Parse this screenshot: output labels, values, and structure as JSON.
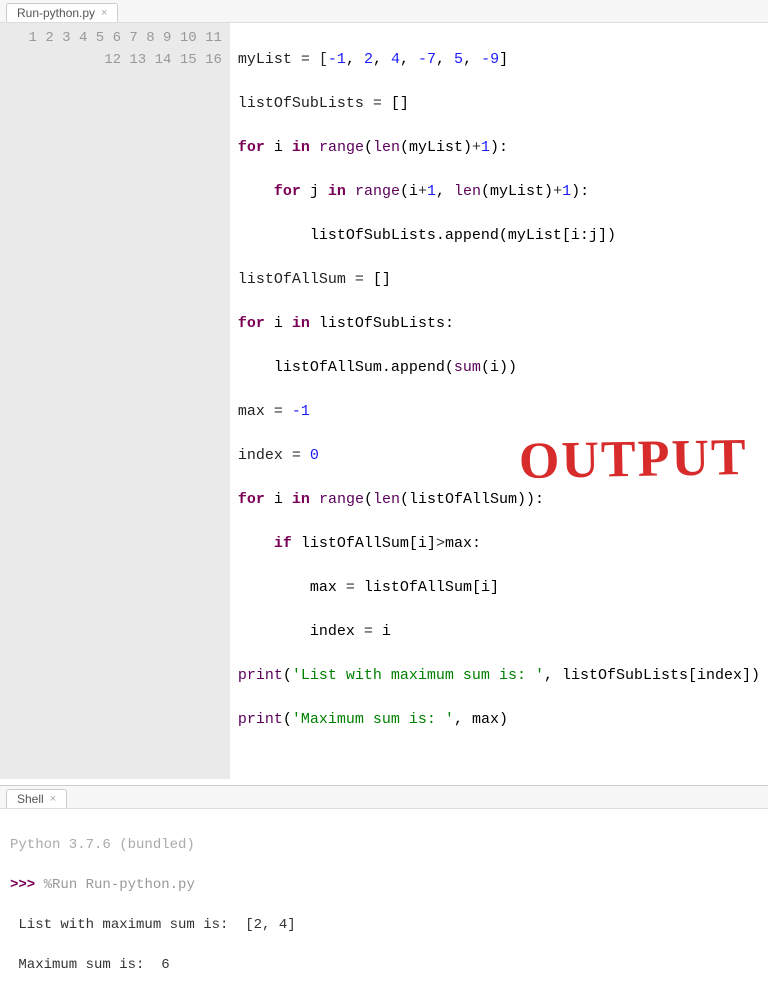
{
  "editor_tab": {
    "label": "Run-python.py"
  },
  "shell_tab": {
    "label": "Shell"
  },
  "gutter_lines": [
    "1",
    "2",
    "3",
    "4",
    "5",
    "6",
    "7",
    "8",
    "9",
    "10",
    "11",
    "12",
    "13",
    "14",
    "15",
    "16"
  ],
  "code": {
    "l1": {
      "a": "myList ",
      "b": "=",
      "c": " [",
      "n1": "-1",
      "c2": ", ",
      "n2": "2",
      "c3": ", ",
      "n3": "4",
      "c4": ", ",
      "n4": "-7",
      "c5": ", ",
      "n5": "5",
      "c6": ", ",
      "n6": "-9",
      "c7": "]"
    },
    "l2": {
      "a": "listOfSubLists ",
      "b": "=",
      "c": " []"
    },
    "l3": {
      "kw": "for",
      "a": " i ",
      "kw2": "in",
      "b": " ",
      "fn": "range",
      "c": "(",
      "fn2": "len",
      "d": "(myList)",
      "op": "+",
      "n": "1",
      "e": "):"
    },
    "l4": {
      "indent": "    ",
      "kw": "for",
      "a": " j ",
      "kw2": "in",
      "b": " ",
      "fn": "range",
      "c": "(i",
      "op": "+",
      "n": "1",
      "d": ", ",
      "fn2": "len",
      "e": "(myList)",
      "op2": "+",
      "n2": "1",
      "f": "):"
    },
    "l5": {
      "indent": "        ",
      "a": "listOfSubLists.append(myList[i:j])"
    },
    "l6": {
      "a": "listOfAllSum ",
      "b": "=",
      "c": " []"
    },
    "l7": {
      "kw": "for",
      "a": " i ",
      "kw2": "in",
      "b": " listOfSubLists:"
    },
    "l8": {
      "indent": "    ",
      "a": "listOfAllSum.append(",
      "fn": "sum",
      "b": "(i))"
    },
    "l9": {
      "a": "max ",
      "b": "=",
      "c": " ",
      "n": "-1"
    },
    "l10": {
      "a": "index ",
      "b": "=",
      "c": " ",
      "n": "0"
    },
    "l11": {
      "kw": "for",
      "a": " i ",
      "kw2": "in",
      "b": " ",
      "fn": "range",
      "c": "(",
      "fn2": "len",
      "d": "(listOfAllSum)):"
    },
    "l12": {
      "indent": "    ",
      "kw": "if",
      "a": " listOfAllSum[i]",
      "op": ">",
      "b": "max:"
    },
    "l13": {
      "indent": "        ",
      "a": "max ",
      "b": "=",
      "c": " listOfAllSum[i]"
    },
    "l14": {
      "indent": "        ",
      "a": "index ",
      "b": "=",
      "c": " i"
    },
    "l15": {
      "fn": "print",
      "a": "(",
      "str": "'List with maximum sum is: '",
      "b": ", listOfSubLists[index])"
    },
    "l16": {
      "fn": "print",
      "a": "(",
      "str": "'Maximum sum is: '",
      "b": ", max)"
    }
  },
  "shell": {
    "version": "Python 3.7.6 (bundled)",
    "prompt": ">>>",
    "run_cmd": "%Run Run-python.py",
    "out1": " List with maximum sum is:  [2, 4]",
    "out2": " Maximum sum is:  6"
  },
  "annotation": "OUTPUT"
}
